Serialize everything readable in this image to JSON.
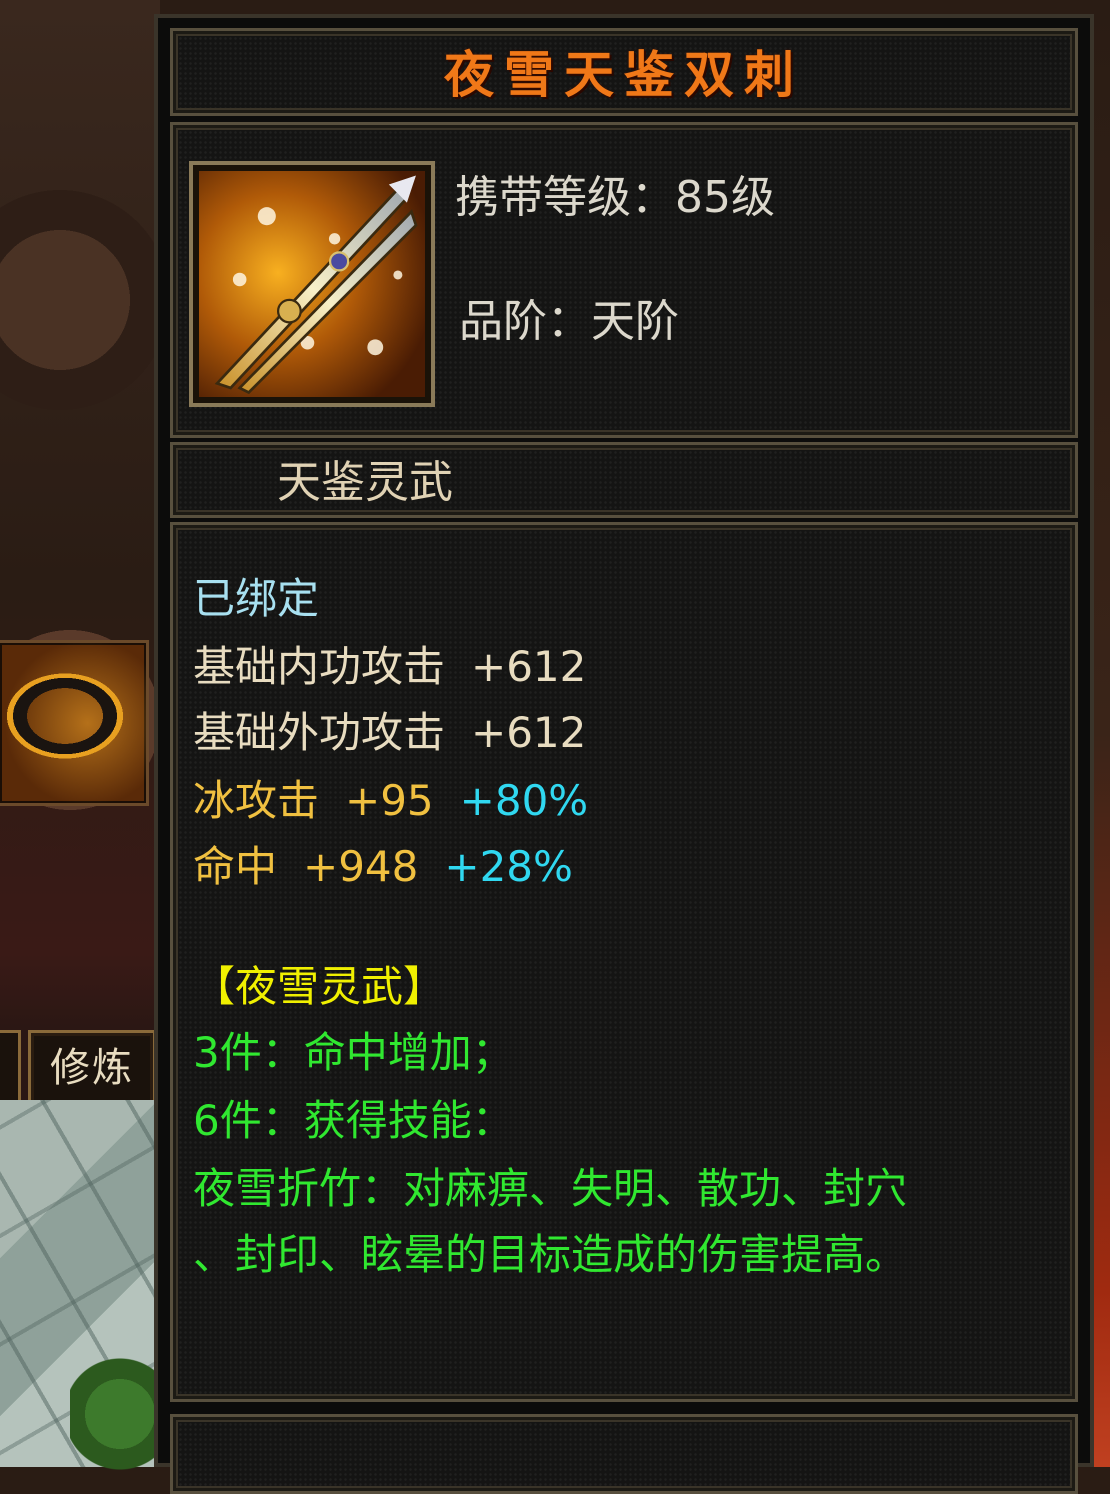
{
  "item": {
    "name": "夜雪天鉴双刺",
    "icon": "twin-daggers-icon",
    "carry_level": "携带等级：85级",
    "grade": "品阶：天阶"
  },
  "set_label": "天鉴灵武",
  "attributes": {
    "bound": "已绑定",
    "base_inner_attack": {
      "label": "基础内功攻击",
      "value": "+612"
    },
    "base_outer_attack": {
      "label": "基础外功攻击",
      "value": "+612"
    },
    "ice_attack": {
      "label": "冰攻击",
      "value": "+95",
      "percent": "+80%"
    },
    "hit": {
      "label": "命中",
      "value": "+948",
      "percent": "+28%"
    }
  },
  "set_bonus": {
    "name": "【夜雪灵武】",
    "bonus_3": "3件：命中增加；",
    "bonus_6": "6件：获得技能：",
    "skill_line_1": "夜雪折竹：对麻痹、失明、散功、封穴",
    "skill_line_2": "、封印、眩晕的目标造成的伤害提高。"
  },
  "background": {
    "cultivate_tab": "修炼",
    "bracelet_icon": "bracelet-icon"
  },
  "colors": {
    "title": "#f07818",
    "bound": "#a8e0f0",
    "base_stat": "#e8dcc0",
    "special_stat": "#f0c040",
    "percent": "#30d8f0",
    "set_name": "#f0f000",
    "set_bonus": "#30e830"
  }
}
